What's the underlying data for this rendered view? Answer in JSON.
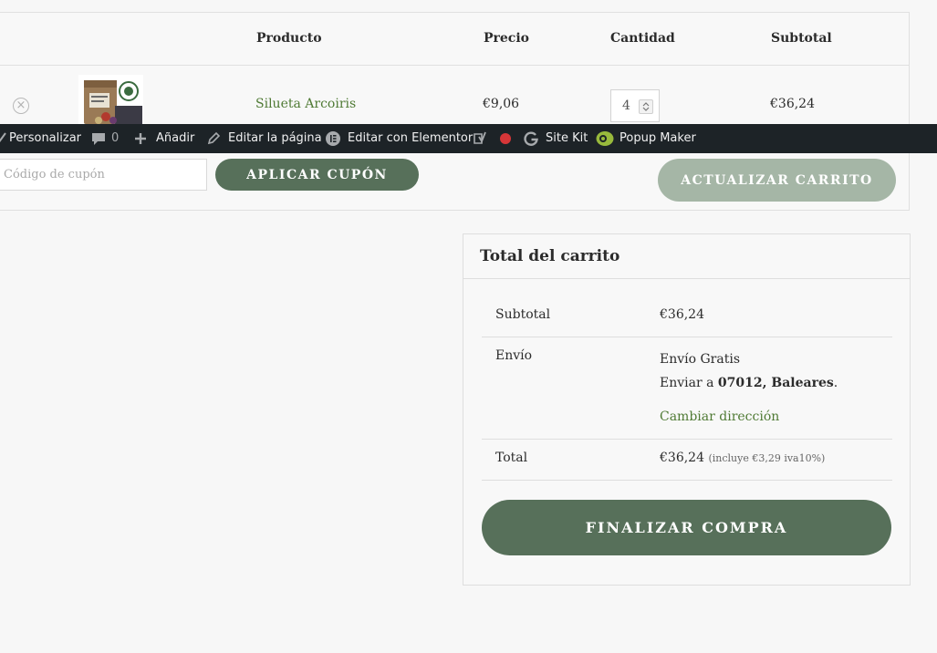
{
  "cart_table": {
    "headers": {
      "product": "Producto",
      "price": "Precio",
      "quantity": "Cantidad",
      "subtotal": "Subtotal"
    },
    "items": [
      {
        "name": "Silueta Arcoiris",
        "price": "€9,06",
        "quantity": "4",
        "subtotal": "€36,24"
      }
    ]
  },
  "admin_bar": {
    "customize": "Personalizar",
    "comments_count": "0",
    "add_new": "Añadir",
    "edit_page": "Editar la página",
    "edit_elementor": "Editar con Elementor",
    "site_kit": "Site Kit",
    "popup_maker": "Popup Maker"
  },
  "actions": {
    "coupon_placeholder": "Código de cupón",
    "apply_coupon": "APLICAR CUPÓN",
    "update_cart": "ACTUALIZAR CARRITO"
  },
  "totals": {
    "title": "Total del carrito",
    "subtotal_label": "Subtotal",
    "subtotal_value": "€36,24",
    "shipping_label": "Envío",
    "shipping_method": "Envío Gratis",
    "ship_to_prefix": "Enviar a",
    "ship_to_location": "07012, Baleares",
    "ship_to_suffix": ".",
    "change_address": "Cambiar dirección",
    "total_label": "Total",
    "total_value": "€36,24",
    "tax_note": "(incluye €3,29 iva10%)",
    "checkout": "FINALIZAR COMPRA"
  },
  "colors": {
    "accent_green": "#57705a",
    "link_green": "#4f7a34",
    "update_disabled": "#a5b6a6",
    "admin_bar_bg": "#1d2327",
    "status_dot": "#d63638"
  },
  "icons": [
    "remove-icon",
    "brush-icon",
    "comment-icon",
    "plus-icon",
    "pencil-icon",
    "elementor-icon",
    "yoast-icon",
    "status-dot-icon",
    "google-icon",
    "popup-maker-icon"
  ]
}
